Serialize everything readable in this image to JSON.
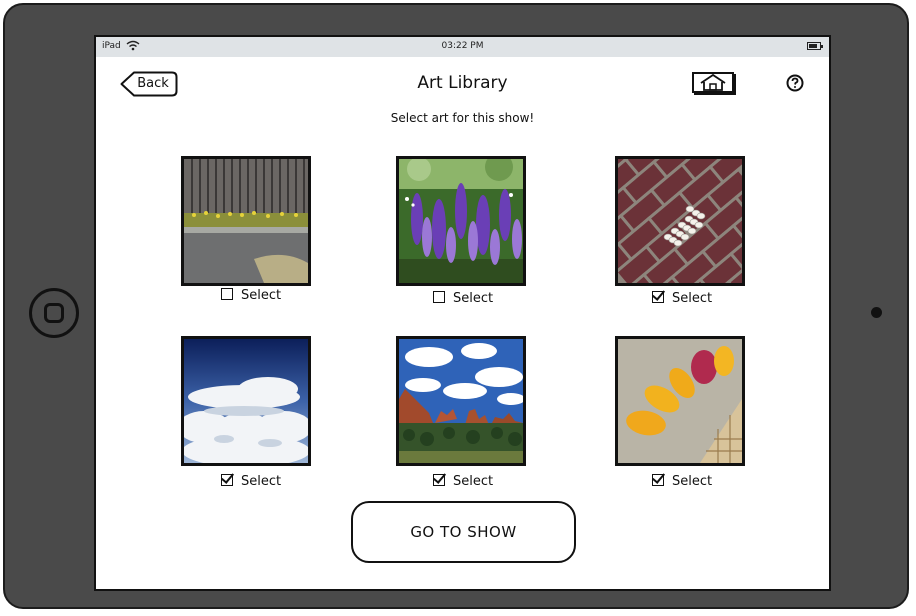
{
  "device": {
    "carrier": "iPad",
    "time": "03:22 PM"
  },
  "header": {
    "back_label": "Back",
    "title": "Art Library",
    "subtitle": "Select art for this show!"
  },
  "artworks": [
    {
      "subject": "wooden fence with flowers",
      "select_label": "Select",
      "selected": false
    },
    {
      "subject": "purple lupine flowers",
      "select_label": "Select",
      "selected": false
    },
    {
      "subject": "brick path with white stones",
      "select_label": "Select",
      "selected": true
    },
    {
      "subject": "clouds from above",
      "select_label": "Select",
      "selected": true
    },
    {
      "subject": "red rock landscape with sky",
      "select_label": "Select",
      "selected": true
    },
    {
      "subject": "mangoes on counter",
      "select_label": "Select",
      "selected": true
    }
  ],
  "footer": {
    "go_label": "GO TO SHOW"
  },
  "icons": {
    "home": "home-icon",
    "help": "help-icon",
    "wifi": "wifi-icon",
    "battery": "battery-icon"
  }
}
